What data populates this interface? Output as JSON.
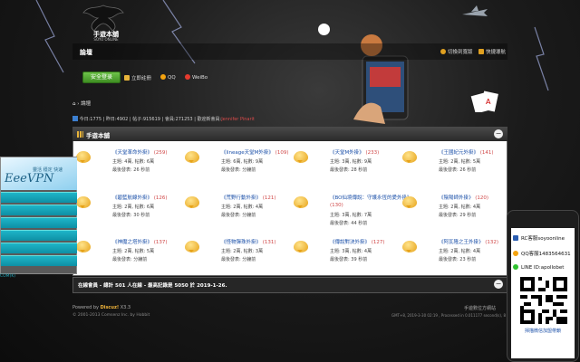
{
  "header": {
    "logo_text": "手遊本舖",
    "logo_sub": "SOYO ONLINE",
    "forum_title": "論壇",
    "switch_style": "切換到寬版",
    "quick_nav": "快捷導航",
    "login_button": "安全登录",
    "register_link": "立即註冊",
    "qq_link": "QQ",
    "weibo_link": "WeiBo",
    "breadcrumb": "論壇",
    "stats": {
      "today_label": "今日:",
      "today": "1775",
      "yesterday_label": "昨日:",
      "yesterday": "4902",
      "posts_label": "帖子:",
      "posts": "915619",
      "members_label": "會員:",
      "members": "271253",
      "new_member_label": "歡迎新會員:",
      "new_member": "Jennifer Pinarit"
    }
  },
  "panel": {
    "title": "手遊本舖",
    "collapse_icon": "collapse-icon",
    "forums": [
      {
        "name": "《天堂革命外掛》",
        "count": "(259)",
        "line1": "主題: 4萬, 帖數: 6萬",
        "line2": "最後發表: 26 秒前"
      },
      {
        "name": "《lineage天堂M外掛》",
        "count": "(109)",
        "line1": "主題: 6萬, 帖數: 9萬",
        "line2": "最後發表: 分鐘前"
      },
      {
        "name": "《天堂M外掛》",
        "count": "(233)",
        "line1": "主題: 3萬, 帖數: 9萬",
        "line2": "最後發表: 28 秒前"
      },
      {
        "name": "《王國紀元外掛》",
        "count": "(141)",
        "line1": "主題: 2萬, 帖數: 5萬",
        "line2": "最後發表: 26 秒前"
      },
      {
        "name": "《碧藍航線外掛》",
        "count": "(126)",
        "line1": "主題: 2萬, 帖數: 6萬",
        "line2": "最後發表: 30 秒前"
      },
      {
        "name": "《荒野行動外掛》",
        "count": "(121)",
        "line1": "主題: 2萬, 帖數: 4萬",
        "line2": "最後發表: 分鐘前"
      },
      {
        "name": "《BO仙境傳說：守護永恆的愛外掛》",
        "count": "(130)",
        "line1": "主題: 3萬, 帖數: 7萬",
        "line2": "最後發表: 44 秒前"
      },
      {
        "name": "《陰陽師外掛》",
        "count": "(120)",
        "line1": "主題: 2萬, 帖數: 4萬",
        "line2": "最後發表: 29 秒前"
      },
      {
        "name": "《神魔之塔外掛》",
        "count": "(137)",
        "line1": "主題: 2萬, 帖數: 5萬",
        "line2": "最後發表: 分鐘前"
      },
      {
        "name": "《怪物彈珠外掛》",
        "count": "(131)",
        "line1": "主題: 2萬, 帖數: 3萬",
        "line2": "最後發表: 分鐘前"
      },
      {
        "name": "《傳說對決外掛》",
        "count": "(127)",
        "line1": "主題: 3萬, 帖數: 4萬",
        "line2": "最後發表: 39 秒前"
      },
      {
        "name": "《阿瓦隆之王外掛》",
        "count": "(132)",
        "line1": "主題: 2萬, 帖數: 4萬",
        "line2": "最後發表: 23 秒前"
      }
    ]
  },
  "online_bar": {
    "text": "在線會員 - 總計 501 人在線 - 最高記錄是 5050 於 2019-1-26."
  },
  "footer": {
    "powered_prefix": "Powered by ",
    "powered_brand": "Discuz!",
    "powered_version": " X3.3",
    "copyright": "© 2001-2013 Comsenz Inc. by Hobbit",
    "right_text": "手遊數位方網站",
    "gmt": "GMT+8, 2019-3-30 02:19 , Processed in 0.011177 second(s), 8 queries ."
  },
  "vpn_ad": {
    "subtitle": "靈活 穩定 快速",
    "logo": "EeeVPN",
    "bottom_text": "COM(K)"
  },
  "qq_ad": {
    "rc_label": "RC客服soyoonline",
    "qq_label": "QQ客服1483564631",
    "line_label": "LINE ID:apollobet",
    "scan_text": "掃描微信加盟帶鎖"
  },
  "colors": {
    "accent_blue": "#1a4fa8",
    "count_red": "#d04848",
    "login_green": "#4fa52f",
    "forum_bubble": "#e6a219"
  }
}
